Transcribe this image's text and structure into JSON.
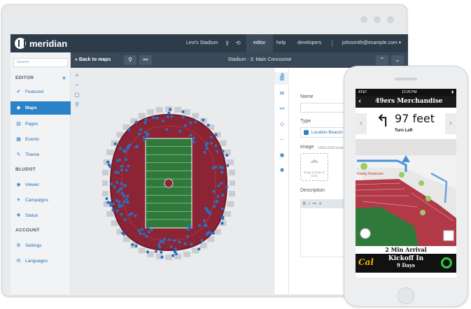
{
  "brand": "meridian",
  "topbar": {
    "venue": "Levi's Stadium",
    "items": [
      "editor",
      "help",
      "developers"
    ],
    "active": "editor",
    "user": "johnsmith@example.com"
  },
  "subbar": {
    "back": "« Back to maps",
    "title": "Stadium - 3: Main Concourse"
  },
  "sidebar": {
    "search_placeholder": "Search",
    "sections": {
      "editor": "EDITOR",
      "bludot": "BLUDOT",
      "account": "ACCOUNT"
    },
    "editor_items": [
      {
        "label": "Featured",
        "icon": "featured-icon"
      },
      {
        "label": "Maps",
        "icon": "maps-icon",
        "active": true
      },
      {
        "label": "Pages",
        "icon": "pages-icon"
      },
      {
        "label": "Events",
        "icon": "events-icon"
      },
      {
        "label": "Theme",
        "icon": "theme-icon"
      }
    ],
    "bludot_items": [
      {
        "label": "Viewer",
        "icon": "viewer-icon"
      },
      {
        "label": "Campaigns",
        "icon": "campaigns-icon"
      },
      {
        "label": "Status",
        "icon": "status-icon"
      }
    ],
    "account_items": [
      {
        "label": "Settings",
        "icon": "settings-icon"
      },
      {
        "label": "Languages",
        "icon": "languages-icon"
      }
    ]
  },
  "panel": {
    "name_label": "Name",
    "type_label": "Type",
    "type_value": "Location Beacon",
    "image_label": "Image",
    "image_dims": "1000x1000 pixels",
    "drop_text": "Drag & Drop or Click",
    "description_label": "Description"
  },
  "phone": {
    "carrier": "AT&T",
    "time": "12:26 PM",
    "header": "49ers Merchandise",
    "distance": "97 feet",
    "direction": "Turn Left",
    "map_label": "Family Restroom",
    "arrival": "2 Min Arrival",
    "kickoff_line1": "Kickoff In",
    "kickoff_line2": "9 Days",
    "team_left": "Cal"
  },
  "colors": {
    "accent": "#2a82c9",
    "topbar": "#2e3c4a",
    "field": "#2f7a3a",
    "seats": "#8b2435",
    "beacon": "#2a6fc1"
  }
}
